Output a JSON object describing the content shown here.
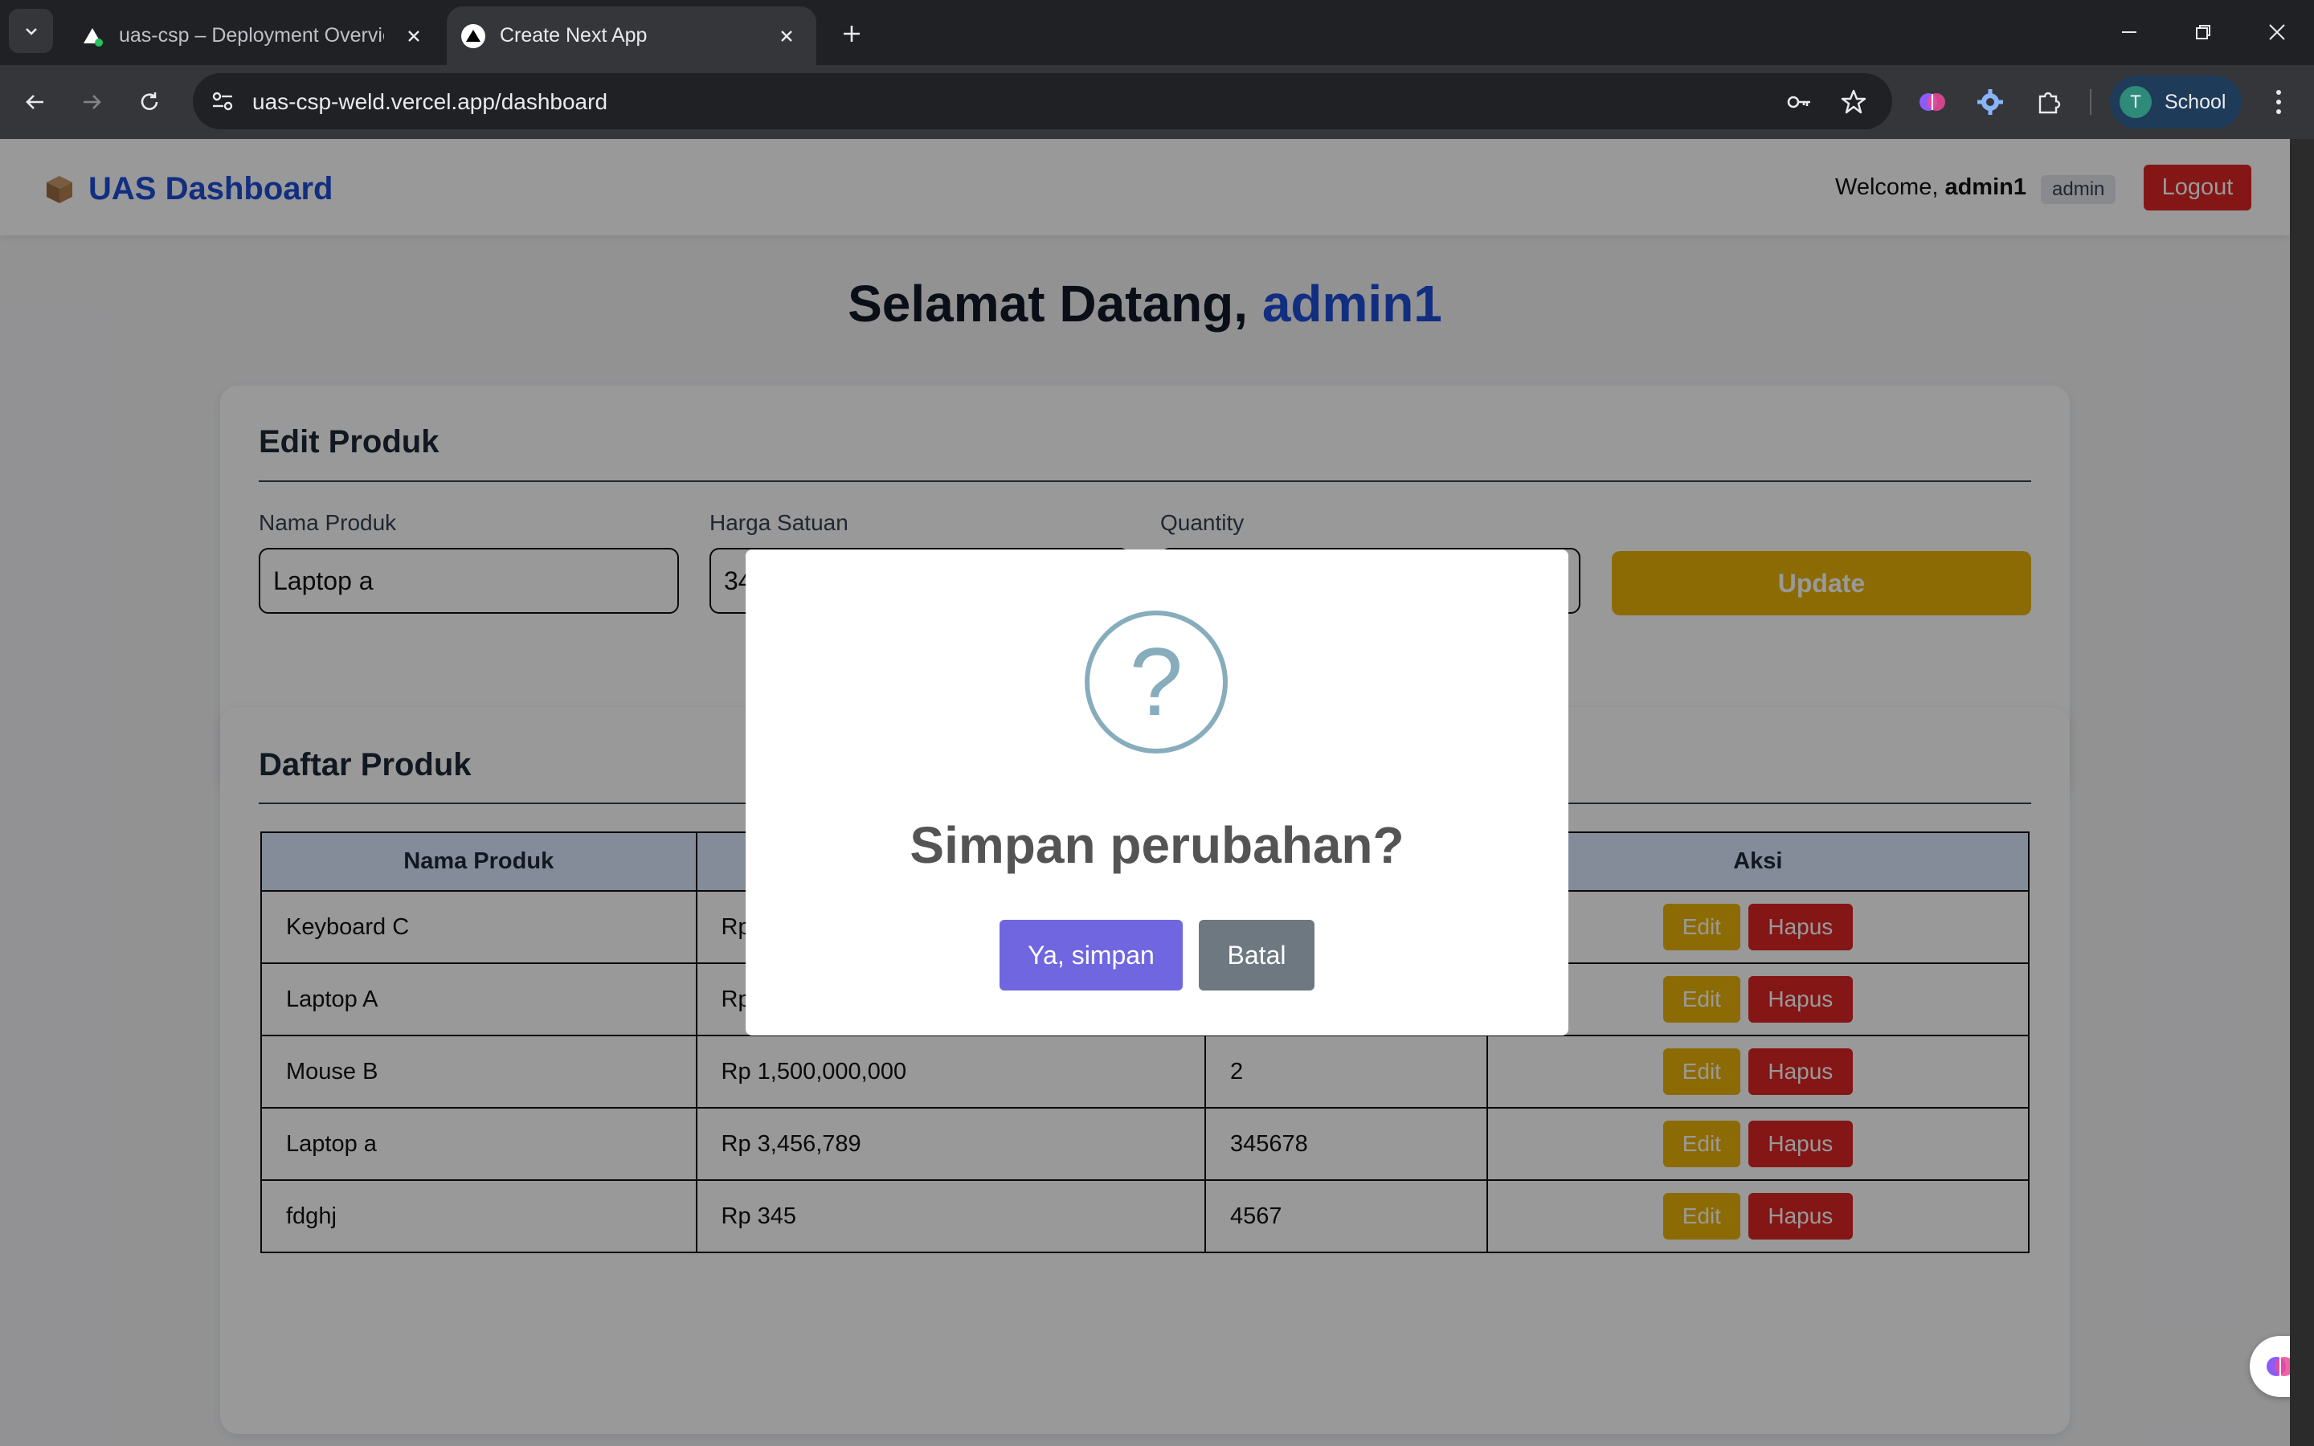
{
  "browser": {
    "tabs": [
      {
        "title": "uas-csp – Deployment Overview",
        "active": false
      },
      {
        "title": "Create Next App",
        "active": true
      }
    ],
    "url": "uas-csp-weld.vercel.app/dashboard",
    "profile": {
      "initial": "T",
      "name": "School"
    }
  },
  "navbar": {
    "brand": "UAS Dashboard",
    "welcome_prefix": "Welcome,",
    "username": "admin1",
    "role": "admin",
    "logout_label": "Logout"
  },
  "greeting": {
    "prefix": "Selamat Datang,",
    "name": "admin1"
  },
  "edit_form": {
    "title": "Edit Produk",
    "fields": [
      {
        "label": "Nama Produk",
        "value": "Laptop a"
      },
      {
        "label": "Harga Satuan",
        "value": "34"
      },
      {
        "label": "Quantity",
        "value": ""
      }
    ],
    "update_label": "Update"
  },
  "product_list": {
    "title": "Daftar Produk",
    "columns": [
      "Nama Produk",
      "",
      "",
      "Aksi"
    ],
    "rows": [
      {
        "name": "Keyboard C",
        "price": "Rp",
        "qty": ""
      },
      {
        "name": "Laptop A",
        "price": "Rp",
        "qty": ""
      },
      {
        "name": "Mouse B",
        "price": "Rp 1,500,000,000",
        "qty": "2"
      },
      {
        "name": "Laptop a",
        "price": "Rp 3,456,789",
        "qty": "345678"
      },
      {
        "name": "fdghj",
        "price": "Rp 345",
        "qty": "4567"
      }
    ],
    "edit_label": "Edit",
    "delete_label": "Hapus"
  },
  "modal": {
    "icon_symbol": "?",
    "title": "Simpan perubahan?",
    "confirm_label": "Ya, simpan",
    "cancel_label": "Batal"
  },
  "colors": {
    "brand_blue": "#1d4ed8",
    "danger": "#dc2626",
    "warning": "#eab308",
    "confirm": "#7066e0",
    "cancel": "#6e7881"
  }
}
